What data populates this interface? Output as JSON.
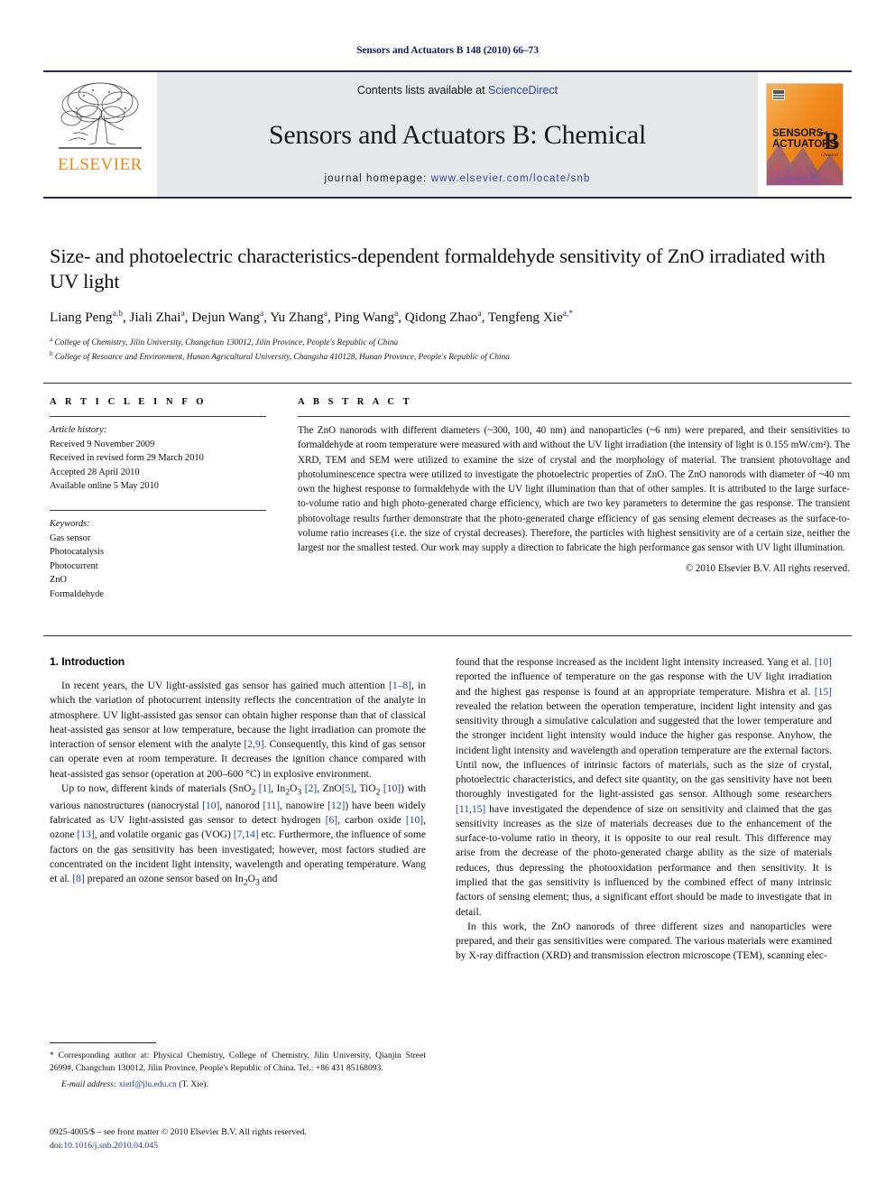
{
  "running_head": "Sensors and Actuators B 148 (2010) 66–73",
  "masthead": {
    "publisher_word": "ELSEVIER",
    "contents_prefix": "Contents lists available at ",
    "contents_link": "ScienceDirect",
    "journal_title": "Sensors and Actuators B: Chemical",
    "homepage_prefix": "journal homepage: ",
    "homepage_url": "www.elsevier.com/locate/snb",
    "cover_line1": "SENSORS",
    "cover_and": "and",
    "cover_line2": "ACTUATORS",
    "cover_letter": "B",
    "cover_sub": "Chemical"
  },
  "title": "Size- and photoelectric characteristics-dependent formaldehyde sensitivity of ZnO irradiated with UV light",
  "authors_html": "Liang Peng<sup>a,b</sup>, Jiali Zhai<sup>a</sup>, Dejun Wang<sup>a</sup>, Yu Zhang<sup>a</sup>, Ping Wang<sup>a</sup>, Qidong Zhao<sup>a</sup>, Tengfeng Xie<sup>a,</sup><sup>*</sup>",
  "affiliation_a": "College of Chemistry, Jilin University, Changchun 130012, Jilin Province, People's Republic of China",
  "affiliation_b": "College of Resource and Environment, Hunan Agricultural University, Changsha 410128, Hunan Province, People's Republic of China",
  "article_info": {
    "heading": "A R T I C L E   I N F O",
    "history_label": "Article history:",
    "history": [
      "Received 9 November 2009",
      "Received in revised form 29 March 2010",
      "Accepted 28 April 2010",
      "Available online 5 May 2010"
    ],
    "keywords_label": "Keywords:",
    "keywords": [
      "Gas sensor",
      "Photocatalysis",
      "Photocurrent",
      "ZnO",
      "Formaldehyde"
    ]
  },
  "abstract": {
    "heading": "A B S T R A C T",
    "text": "The ZnO nanorods with different diameters (~300, 100, 40 nm) and nanoparticles (~6 nm) were prepared, and their sensitivities to formaldehyde at room temperature were measured with and without the UV light irradiation (the intensity of light is 0.155 mW/cm²). The XRD, TEM and SEM were utilized to examine the size of crystal and the morphology of material. The transient photovoltage and photoluminescence spectra were utilized to investigate the photoelectric properties of ZnO. The ZnO nanorods with diameter of ~40 nm own the highest response to formaldehyde with the UV light illumination than that of other samples. It is attributed to the large surface-to-volume ratio and high photo-generated charge efficiency, which are two key parameters to determine the gas response. The transient photovoltage results further demonstrate that the photo-generated charge efficiency of gas sensing element decreases as the surface-to-volume ratio increases (i.e. the size of crystal decreases). Therefore, the particles with highest sensitivity are of a certain size, neither the largest nor the smallest tested. Our work may supply a direction to fabricate the high performance gas sensor with UV light illumination.",
    "copyright": "© 2010 Elsevier B.V. All rights reserved."
  },
  "body": {
    "section_title": "1. Introduction",
    "left_paragraphs": [
      "In recent years, the UV light-assisted gas sensor has gained much attention <span class=\"ref\">[1–8]</span>, in which the variation of photocurrent intensity reflects the concentration of the analyte in atmosphere. UV light-assisted gas sensor can obtain higher response than that of classical heat-assisted gas sensor at low temperature, because the light irradiation can promote the interaction of sensor element with the analyte <span class=\"ref\">[2,9]</span>. Consequently, this kind of gas sensor can operate even at room temperature. It decreases the ignition chance compared with heat-assisted gas sensor (operation at 200–600 °C) in explosive environment.",
      "Up to now, different kinds of materials (SnO<sub>2</sub> <span class=\"ref\">[1]</span>, In<sub>2</sub>O<sub>3</sub> <span class=\"ref\">[2]</span>, ZnO<span class=\"ref\">[5]</span>, TiO<sub>2</sub> <span class=\"ref\">[10]</span>) with various nanostructures (nanocrystal <span class=\"ref\">[10]</span>, nanorod <span class=\"ref\">[11]</span>, nanowire <span class=\"ref\">[12]</span>) have been widely fabricated as UV light-assisted gas sensor to detect hydrogen <span class=\"ref\">[6]</span>, carbon oxide <span class=\"ref\">[10]</span>, ozone <span class=\"ref\">[13]</span>, and volatile organic gas (VOG) <span class=\"ref\">[7,14]</span> etc. Furthermore, the influence of some factors on the gas sensitivity has been investigated; however, most factors studied are concentrated on the incident light intensity, wavelength and operating temperature. Wang et al. <span class=\"ref\">[8]</span> prepared an ozone sensor based on In<sub>2</sub>O<sub>3</sub> and"
    ],
    "right_paragraphs": [
      "found that the response increased as the incident light intensity increased. Yang et al. <span class=\"ref\">[10]</span> reported the influence of temperature on the gas response with the UV light irradiation and the highest gas response is found at an appropriate temperature. Mishra et al. <span class=\"ref\">[15]</span> revealed the relation between the operation temperature, incident light intensity and gas sensitivity through a simulative calculation and suggested that the lower temperature and the stronger incident light intensity would induce the higher gas response. Anyhow, the incident light intensity and wavelength and operation temperature are the external factors. Until now, the influences of intrinsic factors of materials, such as the size of crystal, photoelectric characteristics, and defect site quantity, on the gas sensitivity have not been thoroughly investigated for the light-assisted gas sensor. Although some researchers <span class=\"ref\">[11,15]</span> have investigated the dependence of size on sensitivity and claimed that the gas sensitivity increases as the size of materials decreases due to the enhancement of the surface-to-volume ratio in theory, it is opposite to our real result. This difference may arise from the decrease of the photo-generated charge ability as the size of materials reduces, thus depressing the photooxidation performance and then sensitivity. It is implied that the gas sensitivity is influenced by the combined effect of many intrinsic factors of sensing element; thus, a significant effort should be made to investigate that in detail.",
      "In this work, the ZnO nanorods of three different sizes and nanoparticles were prepared, and their gas sensitivities were compared. The various materials were examined by X-ray diffraction (XRD) and transmission electron microscope (TEM), scanning elec-"
    ]
  },
  "footnote": {
    "corresponding": "<span class=\"star\">*</span> Corresponding author at: Physical Chemistry, College of Chemistry, Jilin University, Qianjin Street 2699#, Changchun 130012, Jilin Province, People's Republic of China. Tel.: +86 431 85168093.",
    "email_label": "E-mail address:",
    "email_address": "xietf@jlu.edu.cn",
    "email_suffix": " (T. Xie)."
  },
  "issn": {
    "line1": "0925-4005/$ – see front matter © 2010 Elsevier B.V. All rights reserved.",
    "doi_label": "doi:",
    "doi_value": "10.1016/j.snb.2010.04.045"
  }
}
